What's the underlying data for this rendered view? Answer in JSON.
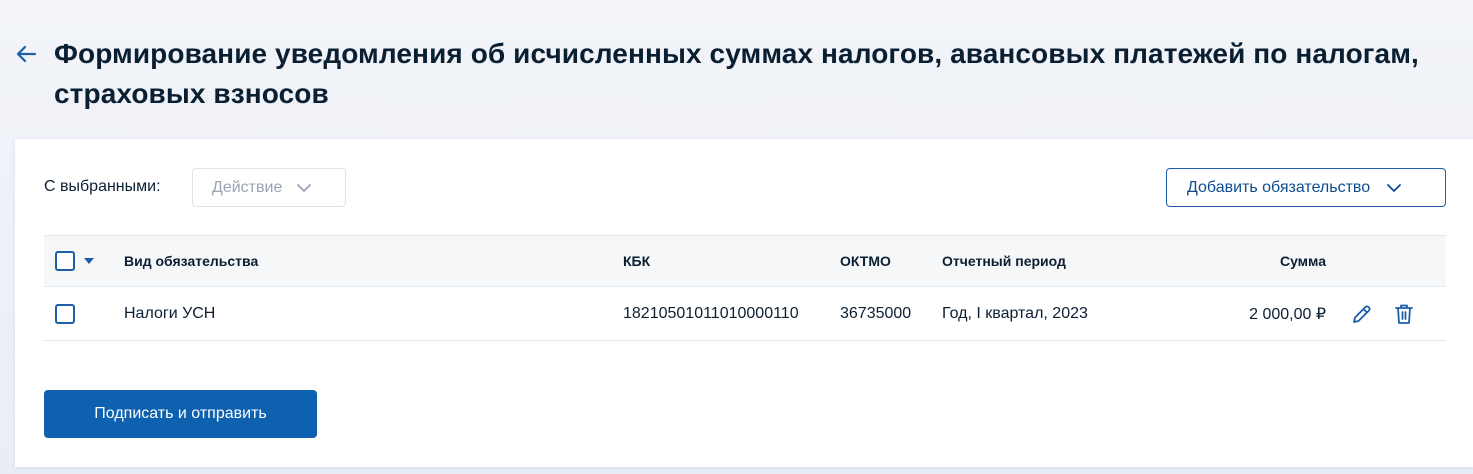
{
  "header": {
    "title": "Формирование уведомления об исчисленных суммах налогов, авансовых платежей по налогам, страховых взносов"
  },
  "toolbar": {
    "selected_label": "С выбранными:",
    "action_placeholder": "Действие",
    "add_button_label": "Добавить обязательство"
  },
  "table": {
    "columns": {
      "type": "Вид обязательства",
      "kbk": "КБК",
      "oktmo": "ОКТМО",
      "period": "Отчетный период",
      "sum": "Сумма"
    },
    "rows": [
      {
        "type": "Налоги УСН",
        "kbk": "18210501011010000110",
        "oktmo": "36735000",
        "period": "Год, I квартал, 2023",
        "sum": "2 000,00 ₽"
      }
    ]
  },
  "footer": {
    "submit_label": "Подписать и отправить"
  },
  "icons": {
    "back": "arrow-left-icon",
    "dropdown": "chevron-down-icon",
    "edit": "pencil-icon",
    "delete": "trash-icon"
  },
  "colors": {
    "accent": "#1d5ea8",
    "primary_button": "#0d61af",
    "text": "#0b1f33",
    "muted": "#9aa4b2"
  }
}
